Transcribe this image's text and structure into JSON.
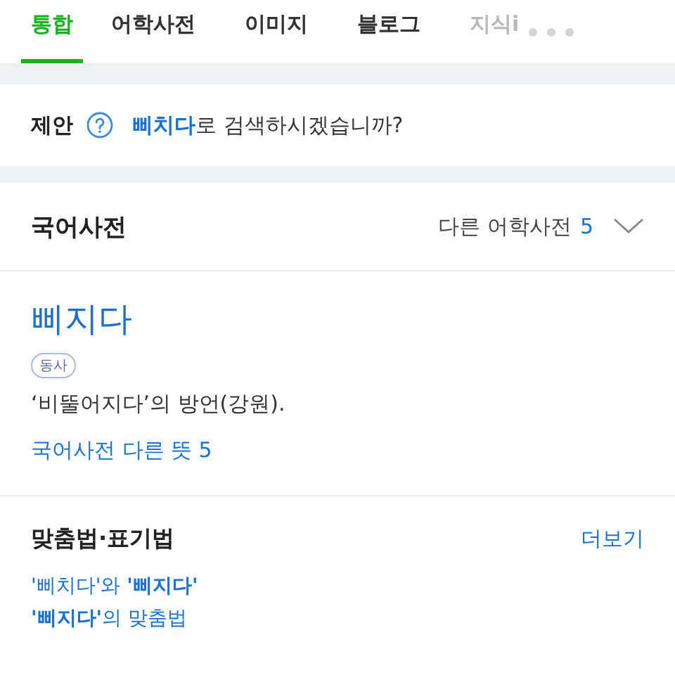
{
  "tabs": [
    {
      "label": "통합",
      "selected": true,
      "faded": false
    },
    {
      "label": "어학사전",
      "selected": false,
      "faded": false
    },
    {
      "label": "이미지",
      "selected": false,
      "faded": false
    },
    {
      "label": "블로그",
      "selected": false,
      "faded": false
    },
    {
      "label": "지식i",
      "selected": false,
      "faded": true
    }
  ],
  "suggestion": {
    "label": "제안",
    "link": "삐치다",
    "rest": "로 검색하시겠습니까?"
  },
  "dictionary": {
    "title": "국어사전",
    "other_label": "다른 어학사전",
    "other_count": "5",
    "entry": {
      "word": "삐지다",
      "part_of_speech": "동사",
      "definition": "‘비뚤어지다’의 방언(강원).",
      "more_link": "국어사전 다른 뜻 5"
    }
  },
  "spelling": {
    "title": "맞춤법·표기법",
    "more": "더보기",
    "links": [
      "'삐치다'와 **'삐지다'**",
      "**'삐지다'**의 맞춤법"
    ]
  }
}
